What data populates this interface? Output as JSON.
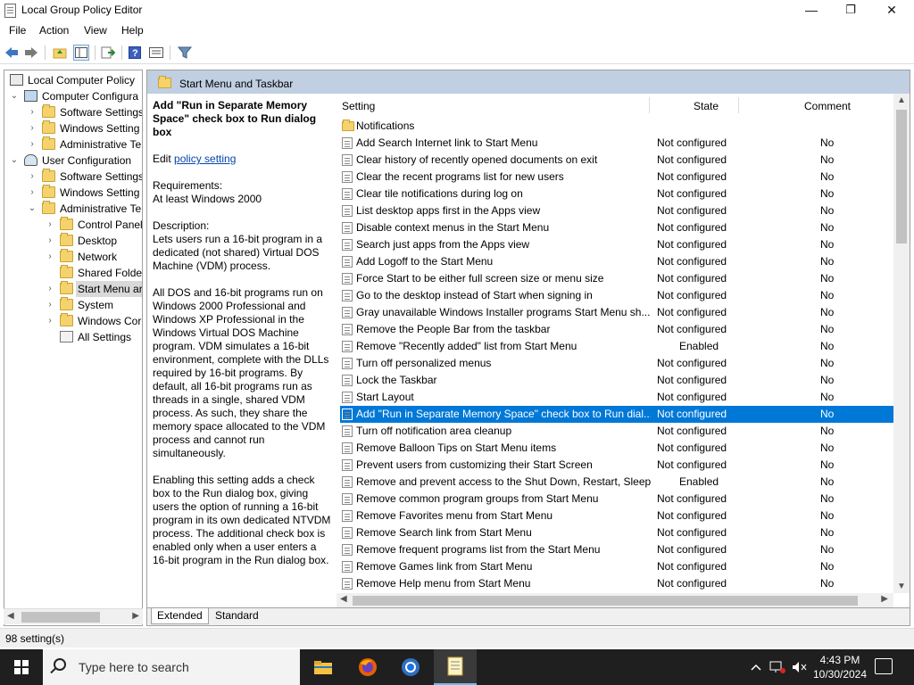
{
  "window": {
    "title": "Local Group Policy Editor",
    "minimize": "—",
    "maximize": "❐",
    "close": "✕"
  },
  "menu": [
    "File",
    "Action",
    "View",
    "Help"
  ],
  "toolbar": {
    "icons": [
      "back-icon",
      "forward-icon",
      "up-folder-icon",
      "show-hide-tree-icon",
      "export-list-icon",
      "help-icon",
      "properties-icon",
      "filter-icon"
    ]
  },
  "tree": {
    "items": [
      {
        "label": "Local Computer Policy",
        "expander": ""
      },
      {
        "label": "Computer Configura",
        "expander": "⌄"
      },
      {
        "label": "Software Settings",
        "expander": "›"
      },
      {
        "label": "Windows Setting",
        "expander": "›"
      },
      {
        "label": "Administrative Te",
        "expander": "›"
      },
      {
        "label": "User Configuration",
        "expander": "⌄"
      },
      {
        "label": "Software Settings",
        "expander": "›"
      },
      {
        "label": "Windows Setting",
        "expander": "›"
      },
      {
        "label": "Administrative Te",
        "expander": "⌄"
      },
      {
        "label": "Control Panel",
        "expander": "›"
      },
      {
        "label": "Desktop",
        "expander": "›"
      },
      {
        "label": "Network",
        "expander": "›"
      },
      {
        "label": "Shared Folder",
        "expander": ""
      },
      {
        "label": "Start Menu ar",
        "expander": "›"
      },
      {
        "label": "System",
        "expander": "›"
      },
      {
        "label": "Windows Cor",
        "expander": "›"
      },
      {
        "label": "All Settings",
        "expander": ""
      }
    ]
  },
  "panel": {
    "header": "Start Menu and Taskbar",
    "description": {
      "title": "Add \"Run in Separate Memory Space\" check box to Run dialog box",
      "edit_prefix": "Edit ",
      "edit_link": "policy setting",
      "requirements_label": "Requirements:",
      "requirements": "At least Windows 2000",
      "description_label": "Description:",
      "p1": "Lets users run a 16-bit program in a dedicated (not shared) Virtual DOS Machine (VDM) process.",
      "p2": "All DOS and 16-bit programs run on Windows 2000 Professional and Windows XP Professional in the Windows Virtual DOS Machine program. VDM simulates a 16-bit environment, complete with the DLLs required by 16-bit programs. By default, all 16-bit programs run as threads in a single, shared VDM process. As such, they share the memory space allocated to the VDM process and cannot run simultaneously.",
      "p3": "Enabling this setting adds a check box to the Run dialog box, giving users the option of running a 16-bit program in its own dedicated NTVDM process. The additional check box is enabled only when a user enters a 16-bit program in the Run dialog box."
    },
    "columns": {
      "setting": "Setting",
      "state": "State",
      "comment": "Comment"
    },
    "folder_row": "Notifications",
    "rows": [
      {
        "name": "Add Search Internet link to Start Menu",
        "state": "Not configured",
        "comment": "No"
      },
      {
        "name": "Clear history of recently opened documents on exit",
        "state": "Not configured",
        "comment": "No"
      },
      {
        "name": "Clear the recent programs list for new users",
        "state": "Not configured",
        "comment": "No"
      },
      {
        "name": "Clear tile notifications during log on",
        "state": "Not configured",
        "comment": "No"
      },
      {
        "name": "List desktop apps first in the Apps view",
        "state": "Not configured",
        "comment": "No"
      },
      {
        "name": "Disable context menus in the Start Menu",
        "state": "Not configured",
        "comment": "No"
      },
      {
        "name": "Search just apps from the Apps view",
        "state": "Not configured",
        "comment": "No"
      },
      {
        "name": "Add Logoff to the Start Menu",
        "state": "Not configured",
        "comment": "No"
      },
      {
        "name": "Force Start to be either full screen size or menu size",
        "state": "Not configured",
        "comment": "No"
      },
      {
        "name": "Go to the desktop instead of Start when signing in",
        "state": "Not configured",
        "comment": "No"
      },
      {
        "name": "Gray unavailable Windows Installer programs Start Menu sh...",
        "state": "Not configured",
        "comment": "No"
      },
      {
        "name": "Remove the People Bar from the taskbar",
        "state": "Not configured",
        "comment": "No"
      },
      {
        "name": "Remove \"Recently added\" list from Start Menu",
        "state": "Enabled",
        "comment": "No"
      },
      {
        "name": "Turn off personalized menus",
        "state": "Not configured",
        "comment": "No"
      },
      {
        "name": "Lock the Taskbar",
        "state": "Not configured",
        "comment": "No"
      },
      {
        "name": "Start Layout",
        "state": "Not configured",
        "comment": "No"
      },
      {
        "name": "Add \"Run in Separate Memory Space\" check box to Run dial...",
        "state": "Not configured",
        "comment": "No",
        "selected": true
      },
      {
        "name": "Turn off notification area cleanup",
        "state": "Not configured",
        "comment": "No"
      },
      {
        "name": "Remove Balloon Tips on Start Menu items",
        "state": "Not configured",
        "comment": "No"
      },
      {
        "name": "Prevent users from customizing their Start Screen",
        "state": "Not configured",
        "comment": "No"
      },
      {
        "name": "Remove and prevent access to the Shut Down, Restart, Sleep...",
        "state": "Enabled",
        "comment": "No"
      },
      {
        "name": "Remove common program groups from Start Menu",
        "state": "Not configured",
        "comment": "No"
      },
      {
        "name": "Remove Favorites menu from Start Menu",
        "state": "Not configured",
        "comment": "No"
      },
      {
        "name": "Remove Search link from Start Menu",
        "state": "Not configured",
        "comment": "No"
      },
      {
        "name": "Remove frequent programs list from the Start Menu",
        "state": "Not configured",
        "comment": "No"
      },
      {
        "name": "Remove Games link from Start Menu",
        "state": "Not configured",
        "comment": "No"
      },
      {
        "name": "Remove Help menu from Start Menu",
        "state": "Not configured",
        "comment": "No"
      }
    ],
    "tabs": [
      "Extended",
      "Standard"
    ]
  },
  "status": "98 setting(s)",
  "taskbar": {
    "search_placeholder": "Type here to search",
    "apps": [
      "file-explorer-icon",
      "firefox-icon",
      "chrome-icon",
      "group-policy-editor-icon"
    ],
    "time": "4:43 PM",
    "date": "10/30/2024",
    "selection_color": "#0078d7"
  }
}
